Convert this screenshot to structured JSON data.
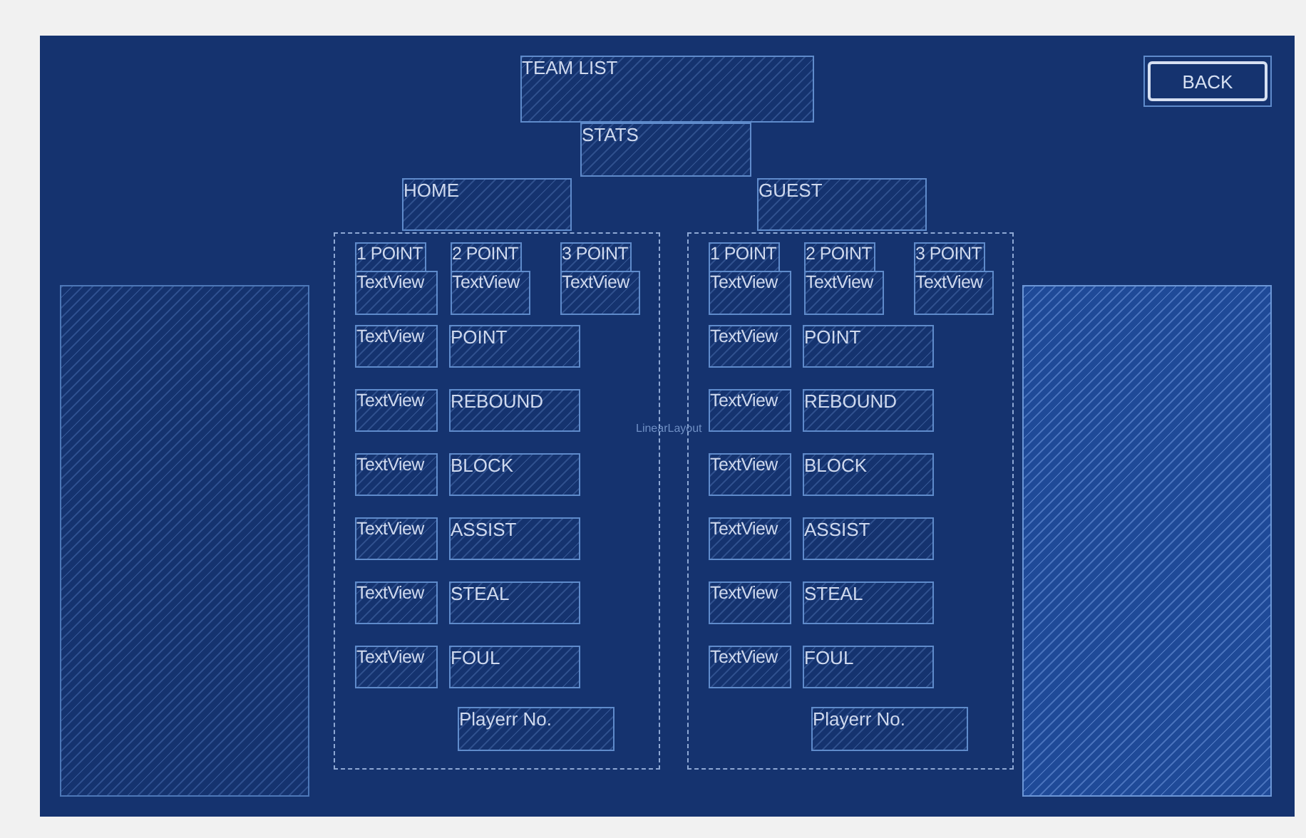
{
  "header": {
    "title": "TEAM LIST",
    "subtitle": "STATS",
    "back_button": "BACK"
  },
  "layout_label": "LinearLayout",
  "teams": [
    {
      "name": "HOME",
      "point_headers": [
        "1 POINT",
        "2 POINT",
        "3 POINT"
      ],
      "point_values": [
        "TextView",
        "TextView",
        "TextView"
      ],
      "stats": [
        {
          "value": "TextView",
          "label": "POINT"
        },
        {
          "value": "TextView",
          "label": "REBOUND"
        },
        {
          "value": "TextView",
          "label": "BLOCK"
        },
        {
          "value": "TextView",
          "label": "ASSIST"
        },
        {
          "value": "TextView",
          "label": "STEAL"
        },
        {
          "value": "TextView",
          "label": "FOUL"
        }
      ],
      "player_label": "Playerr No."
    },
    {
      "name": "GUEST",
      "point_headers": [
        "1 POINT",
        "2 POINT",
        "3 POINT"
      ],
      "point_values": [
        "TextView",
        "TextView",
        "TextView"
      ],
      "stats": [
        {
          "value": "TextView",
          "label": "POINT"
        },
        {
          "value": "TextView",
          "label": "REBOUND"
        },
        {
          "value": "TextView",
          "label": "BLOCK"
        },
        {
          "value": "TextView",
          "label": "ASSIST"
        },
        {
          "value": "TextView",
          "label": "STEAL"
        },
        {
          "value": "TextView",
          "label": "FOUL"
        }
      ],
      "player_label": "Playerr No."
    }
  ],
  "side_panels": [
    {
      "selected": false
    },
    {
      "selected": true
    }
  ]
}
